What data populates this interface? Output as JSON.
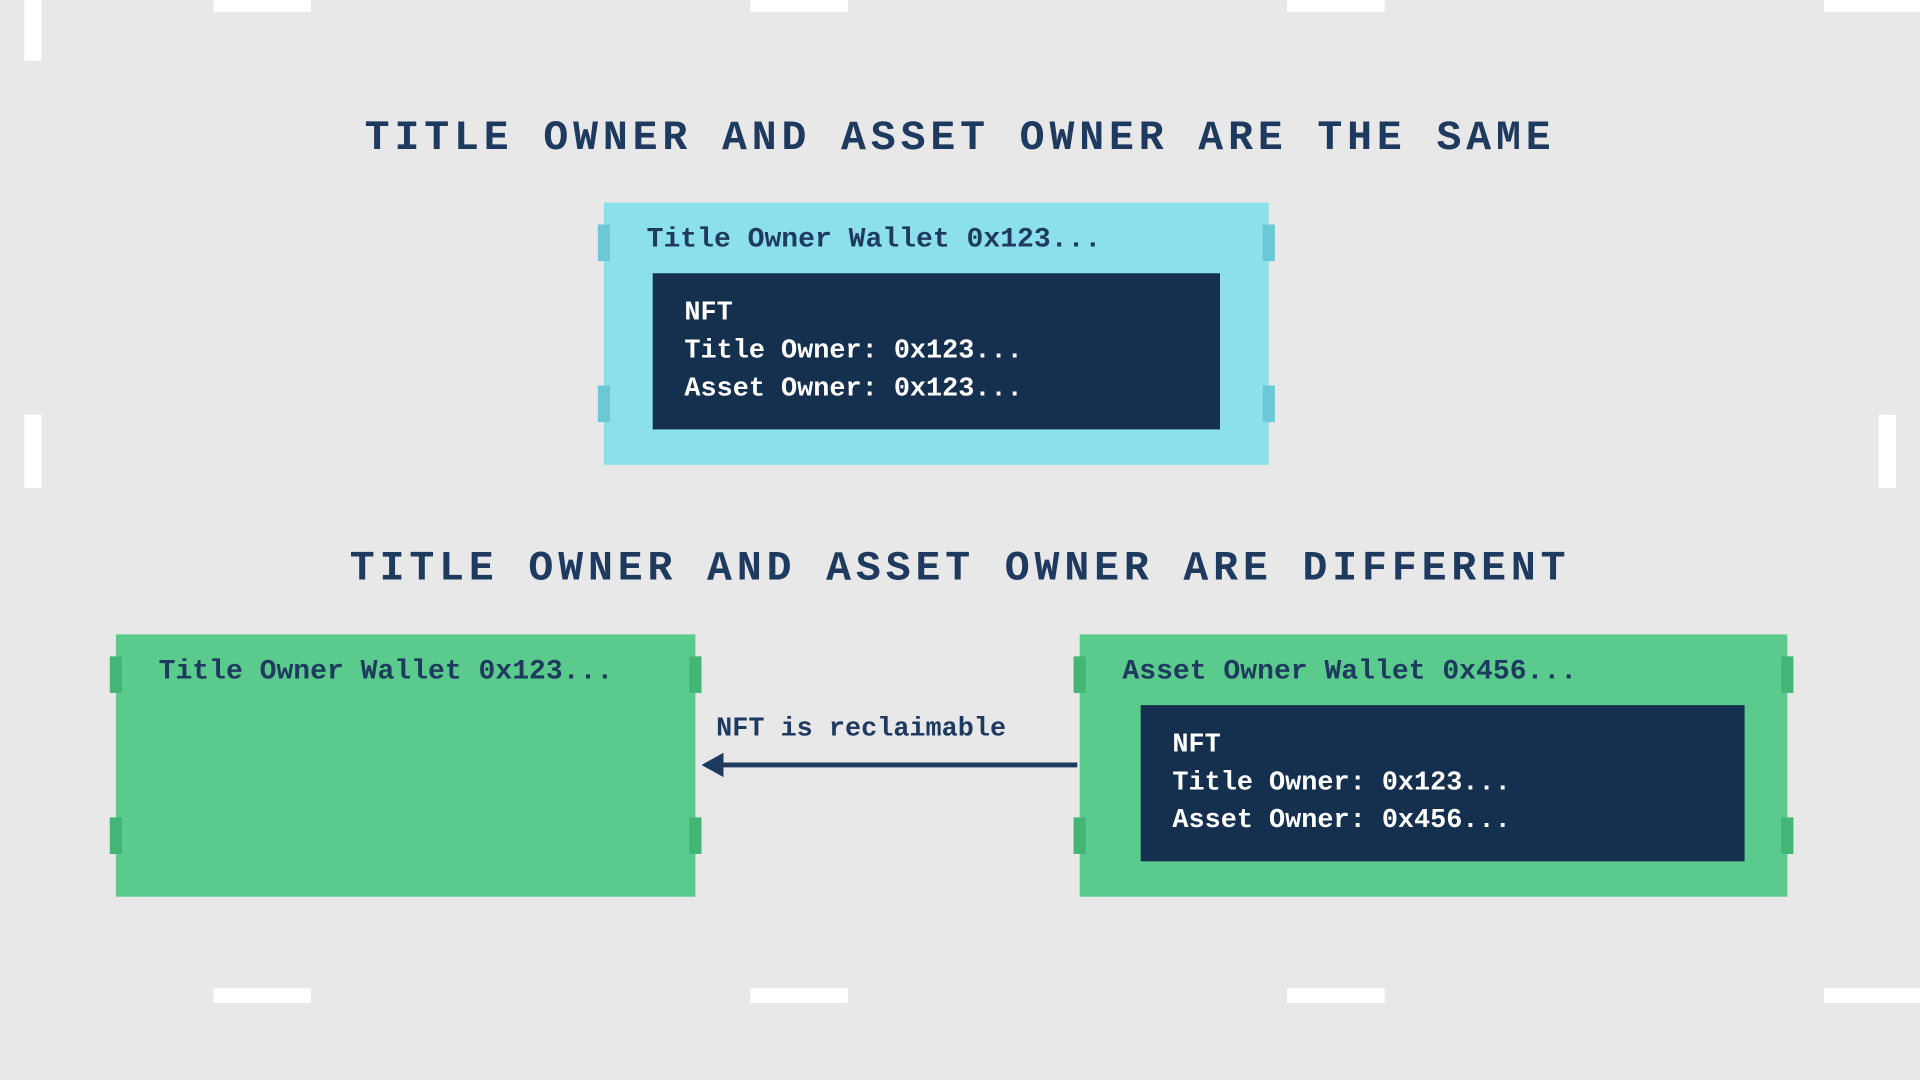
{
  "colors": {
    "background": "#e8e8e8",
    "navy": "#1f3a5f",
    "navy_dark": "#15304e",
    "cyan": "#8be0ec",
    "cyan_accent": "#6bc9d6",
    "green": "#5acb8c",
    "green_accent": "#43b676",
    "white": "#ffffff"
  },
  "section_same": {
    "heading": "TITLE OWNER AND ASSET OWNER ARE THE SAME",
    "wallet": {
      "label": "Title Owner Wallet 0x123...",
      "nft": {
        "title": "NFT",
        "title_owner_label": "Title Owner:",
        "title_owner_value": "0x123...",
        "asset_owner_label": "Asset Owner:",
        "asset_owner_value": "0x123..."
      }
    }
  },
  "section_diff": {
    "heading": "TITLE OWNER AND ASSET OWNER ARE DIFFERENT",
    "title_wallet": {
      "label": "Title Owner Wallet 0x123..."
    },
    "asset_wallet": {
      "label": "Asset Owner Wallet 0x456...",
      "nft": {
        "title": "NFT",
        "title_owner_label": "Title Owner:",
        "title_owner_value": "0x123...",
        "asset_owner_label": "Asset Owner:",
        "asset_owner_value": "0x456..."
      }
    },
    "arrow_label": "NFT is reclaimable"
  }
}
